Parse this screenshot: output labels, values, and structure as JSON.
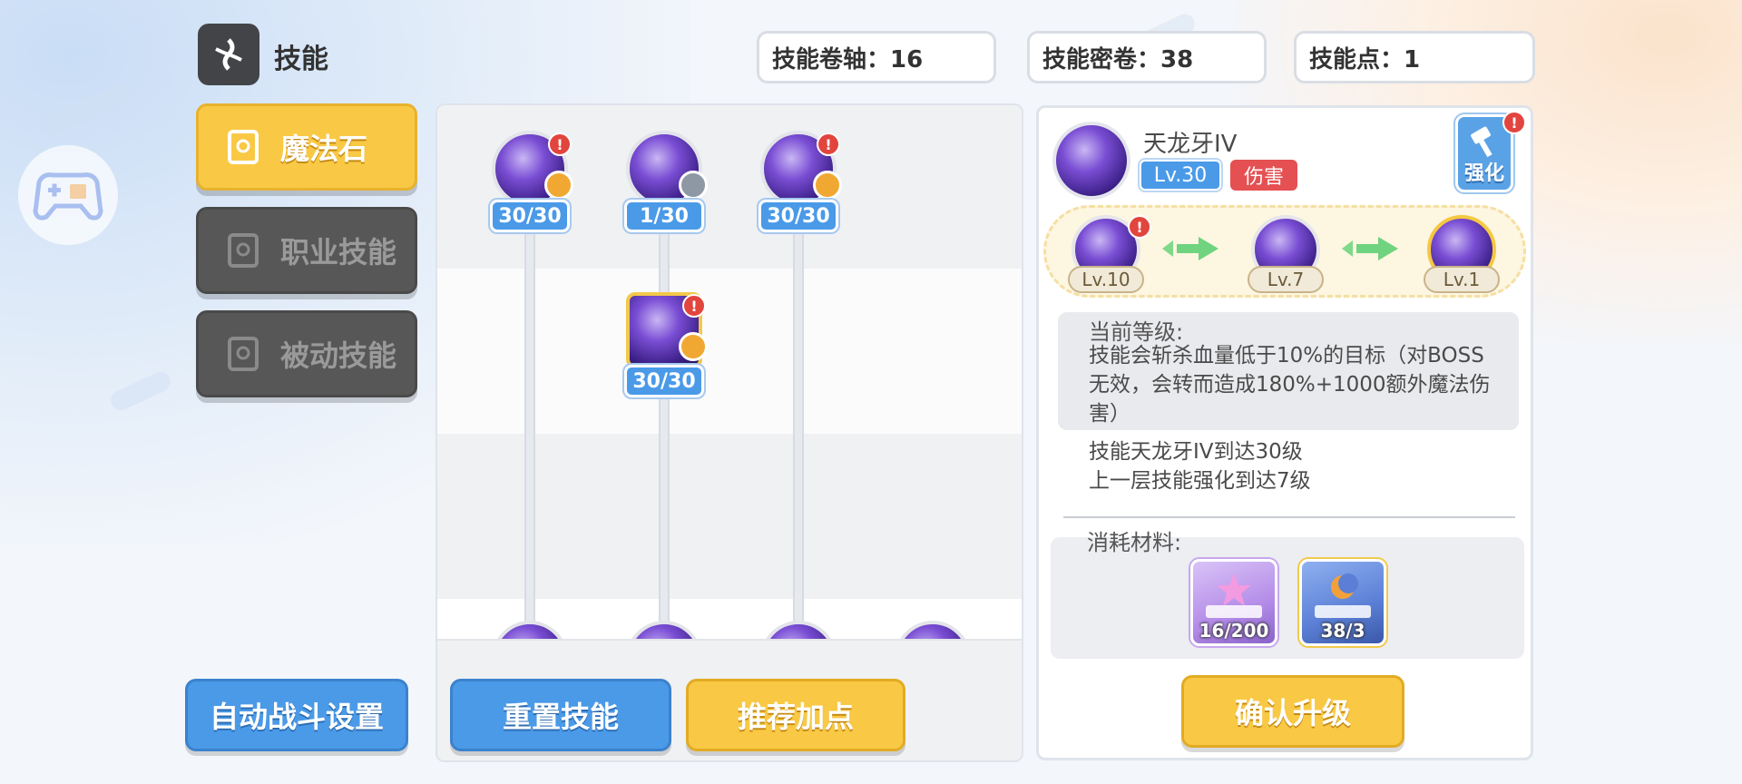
{
  "header": {
    "title": "技能",
    "counters": [
      {
        "label": "技能卷轴：16"
      },
      {
        "label": "技能密卷：38"
      },
      {
        "label": "技能点：1"
      }
    ]
  },
  "sidebar": {
    "tabs": [
      {
        "label": "魔法石",
        "active": true
      },
      {
        "label": "职业技能",
        "active": false
      },
      {
        "label": "被动技能",
        "active": false
      }
    ],
    "auto_battle_label": "自动战斗设置"
  },
  "tree": {
    "nodes": [
      {
        "level": "30/30",
        "alert": "!",
        "badge": "gold"
      },
      {
        "level": "1/30",
        "alert": "",
        "badge": "grey"
      },
      {
        "level": "30/30",
        "alert": "!",
        "badge": "gold"
      },
      {
        "level": "30/30",
        "alert": "!",
        "badge": "gold",
        "selected": true
      }
    ],
    "reset_label": "重置技能",
    "recommend_label": "推荐加点"
  },
  "detail": {
    "name": "天龙牙IV",
    "level_tag": "Lv.30",
    "type_tag": "伤害",
    "enhance_label": "强化",
    "chain": [
      "Lv.10",
      "Lv.7",
      "Lv.1"
    ],
    "current_label": "当前等级:",
    "current_desc_1": "技能会斩杀血量低于10%的目标（对BOSS",
    "current_desc_2": "无效，会转而造成180%+1000额外魔法伤",
    "current_desc_3": "害）",
    "req_1": "技能天龙牙IV到达30级",
    "req_2": "上一层技能强化到达7级",
    "materials_label": "消耗材料:",
    "materials": [
      {
        "count": "16/200",
        "color": "#b48ce8"
      },
      {
        "count": "38/3",
        "color": "#5b7fd6"
      }
    ],
    "confirm_label": "确认升级"
  },
  "colors": {
    "accent_yellow": "#f9c945",
    "accent_blue": "#4a9ae8",
    "alert_red": "#e2443e"
  }
}
